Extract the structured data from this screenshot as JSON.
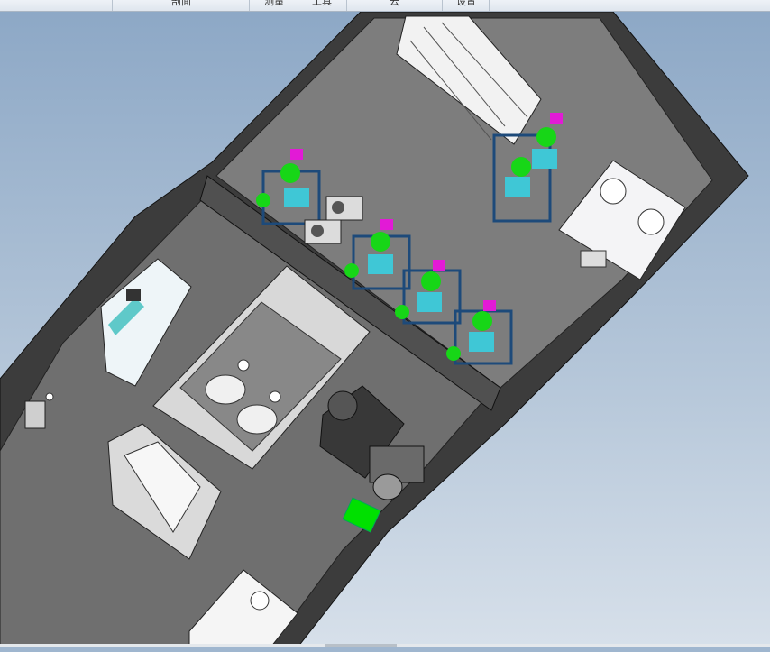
{
  "ribbon": {
    "tabs": [
      {
        "label": "剖面"
      },
      {
        "label": "测量"
      },
      {
        "label": "工具"
      },
      {
        "label": "云"
      },
      {
        "label": "设置"
      }
    ]
  },
  "viewport": {
    "scene": "3d-model",
    "colors": {
      "background_top": "#8da8c6",
      "background_bottom": "#d7e0ea",
      "floor": "#7d7d7d",
      "wall": "#3c3c3c",
      "frame": "#1d4a7a",
      "tank": "#17d617",
      "pipe": "#3fc7d6",
      "motor": "#e21ad6",
      "box": "#00e000"
    }
  }
}
